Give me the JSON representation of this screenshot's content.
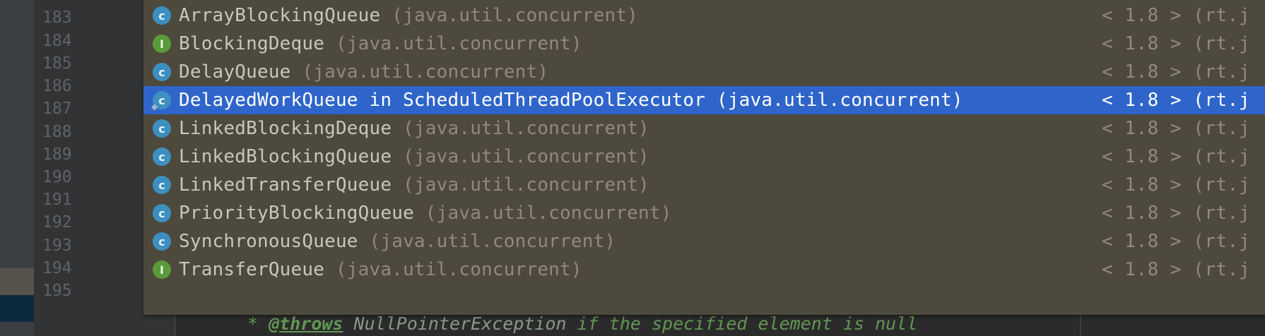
{
  "gutter": {
    "line_numbers": [
      "183",
      "184",
      "185",
      "186",
      "187",
      "188",
      "189",
      "190",
      "191",
      "192",
      "193",
      "194",
      "195"
    ]
  },
  "editor": {
    "doc_line": {
      "star": "*",
      "tag": "@throws",
      "exception": "NullPointerException",
      "text": "if the specified element is null"
    }
  },
  "completion_popup": {
    "items": [
      {
        "kind": "class",
        "icon_letter": "c",
        "name": "ArrayBlockingQueue",
        "package": "(java.util.concurrent)",
        "version": "< 1.8 > (rt.j",
        "selected": false
      },
      {
        "kind": "interface",
        "icon_letter": "I",
        "name": "BlockingDeque",
        "package": "(java.util.concurrent)",
        "version": "< 1.8 > (rt.j",
        "selected": false
      },
      {
        "kind": "class",
        "icon_letter": "c",
        "name": "DelayQueue",
        "package": "(java.util.concurrent)",
        "version": "< 1.8 > (rt.j",
        "selected": false
      },
      {
        "kind": "class",
        "icon_letter": "c",
        "name": "DelayedWorkQueue in ScheduledThreadPoolExecutor",
        "package": "(java.util.concurrent)",
        "version": "< 1.8 > (rt.j",
        "selected": true
      },
      {
        "kind": "class",
        "icon_letter": "c",
        "name": "LinkedBlockingDeque",
        "package": "(java.util.concurrent)",
        "version": "< 1.8 > (rt.j",
        "selected": false
      },
      {
        "kind": "class",
        "icon_letter": "c",
        "name": "LinkedBlockingQueue",
        "package": "(java.util.concurrent)",
        "version": "< 1.8 > (rt.j",
        "selected": false
      },
      {
        "kind": "class",
        "icon_letter": "c",
        "name": "LinkedTransferQueue",
        "package": "(java.util.concurrent)",
        "version": "< 1.8 > (rt.j",
        "selected": false
      },
      {
        "kind": "class",
        "icon_letter": "c",
        "name": "PriorityBlockingQueue",
        "package": "(java.util.concurrent)",
        "version": "< 1.8 > (rt.j",
        "selected": false
      },
      {
        "kind": "class",
        "icon_letter": "c",
        "name": "SynchronousQueue",
        "package": "(java.util.concurrent)",
        "version": "< 1.8 > (rt.j",
        "selected": false
      },
      {
        "kind": "interface",
        "icon_letter": "I",
        "name": "TransferQueue",
        "package": "(java.util.concurrent)",
        "version": "< 1.8 > (rt.j",
        "selected": false
      }
    ]
  },
  "colors": {
    "popup_bg": "#4d493c",
    "selection": "#2f65ca",
    "class_icon": "#3d8fbf",
    "interface_icon": "#5a9a3a",
    "doc_comment": "#629755"
  }
}
